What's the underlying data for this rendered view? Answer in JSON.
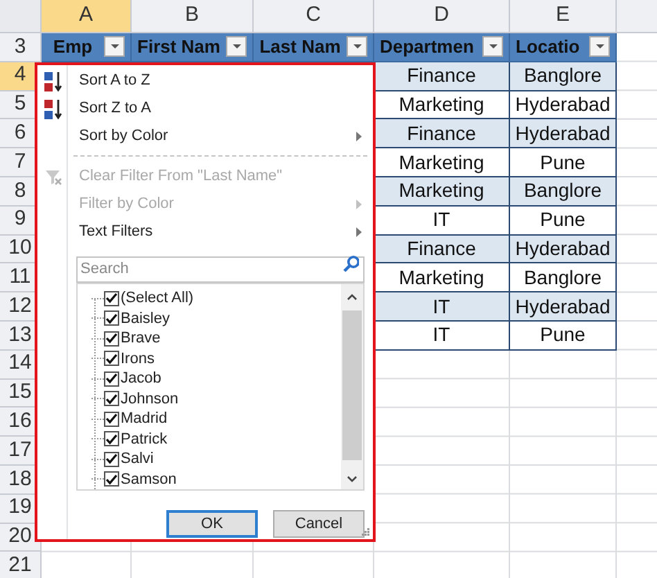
{
  "column_headers": [
    {
      "label": "A",
      "selected": true
    },
    {
      "label": "B",
      "selected": false
    },
    {
      "label": "C",
      "selected": false
    },
    {
      "label": "D",
      "selected": false
    },
    {
      "label": "E",
      "selected": false
    }
  ],
  "row_headers": [
    {
      "label": "3",
      "selected": false
    },
    {
      "label": "4",
      "selected": true
    },
    {
      "label": "5",
      "selected": false
    },
    {
      "label": "6",
      "selected": false
    },
    {
      "label": "7",
      "selected": false
    },
    {
      "label": "8",
      "selected": false
    },
    {
      "label": "9",
      "selected": false
    },
    {
      "label": "10",
      "selected": false
    },
    {
      "label": "11",
      "selected": false
    },
    {
      "label": "12",
      "selected": false
    },
    {
      "label": "13",
      "selected": false
    },
    {
      "label": "14",
      "selected": false
    },
    {
      "label": "15",
      "selected": false
    },
    {
      "label": "16",
      "selected": false
    },
    {
      "label": "17",
      "selected": false
    },
    {
      "label": "18",
      "selected": false
    },
    {
      "label": "19",
      "selected": false
    },
    {
      "label": "20",
      "selected": false
    },
    {
      "label": "21",
      "selected": false
    }
  ],
  "table": {
    "columns": [
      {
        "label": "Emp"
      },
      {
        "label": "First Nam"
      },
      {
        "label": "Last Nam"
      },
      {
        "label": "Departmen"
      },
      {
        "label": "Locatio"
      }
    ],
    "rows": [
      {
        "department": "Finance",
        "location": "Banglore"
      },
      {
        "department": "Marketing",
        "location": "Hyderabad"
      },
      {
        "department": "Finance",
        "location": "Hyderabad"
      },
      {
        "department": "Marketing",
        "location": "Pune"
      },
      {
        "department": "Marketing",
        "location": "Banglore"
      },
      {
        "department": "IT",
        "location": "Pune"
      },
      {
        "department": "Finance",
        "location": "Hyderabad"
      },
      {
        "department": "Marketing",
        "location": "Banglore"
      },
      {
        "department": "IT",
        "location": "Hyderabad"
      },
      {
        "department": "IT",
        "location": "Pune"
      }
    ]
  },
  "filter_menu": {
    "items": [
      {
        "kind": "sort-asc",
        "label": "Sort A to Z",
        "disabled": false,
        "submenu": false
      },
      {
        "kind": "sort-desc",
        "label": "Sort Z to A",
        "disabled": false,
        "submenu": false
      },
      {
        "kind": "plain",
        "label": "Sort by Color",
        "disabled": false,
        "submenu": true
      },
      {
        "kind": "separator"
      },
      {
        "kind": "clear-filter",
        "label": "Clear Filter From \"Last Name\"",
        "disabled": true,
        "submenu": false
      },
      {
        "kind": "plain",
        "label": "Filter by Color",
        "disabled": true,
        "submenu": true
      },
      {
        "kind": "plain",
        "label": "Text Filters",
        "disabled": false,
        "submenu": true
      }
    ],
    "search": {
      "placeholder": "Search"
    },
    "values": [
      {
        "label": "(Select All)",
        "checked": true
      },
      {
        "label": "Baisley",
        "checked": true
      },
      {
        "label": "Brave",
        "checked": true
      },
      {
        "label": "Irons",
        "checked": true
      },
      {
        "label": "Jacob",
        "checked": true
      },
      {
        "label": "Johnson",
        "checked": true
      },
      {
        "label": "Madrid",
        "checked": true
      },
      {
        "label": "Patrick",
        "checked": true
      },
      {
        "label": "Salvi",
        "checked": true
      },
      {
        "label": "Samson",
        "checked": true
      }
    ],
    "buttons": [
      {
        "label": "OK",
        "default": true
      },
      {
        "label": "Cancel",
        "default": false
      }
    ]
  }
}
